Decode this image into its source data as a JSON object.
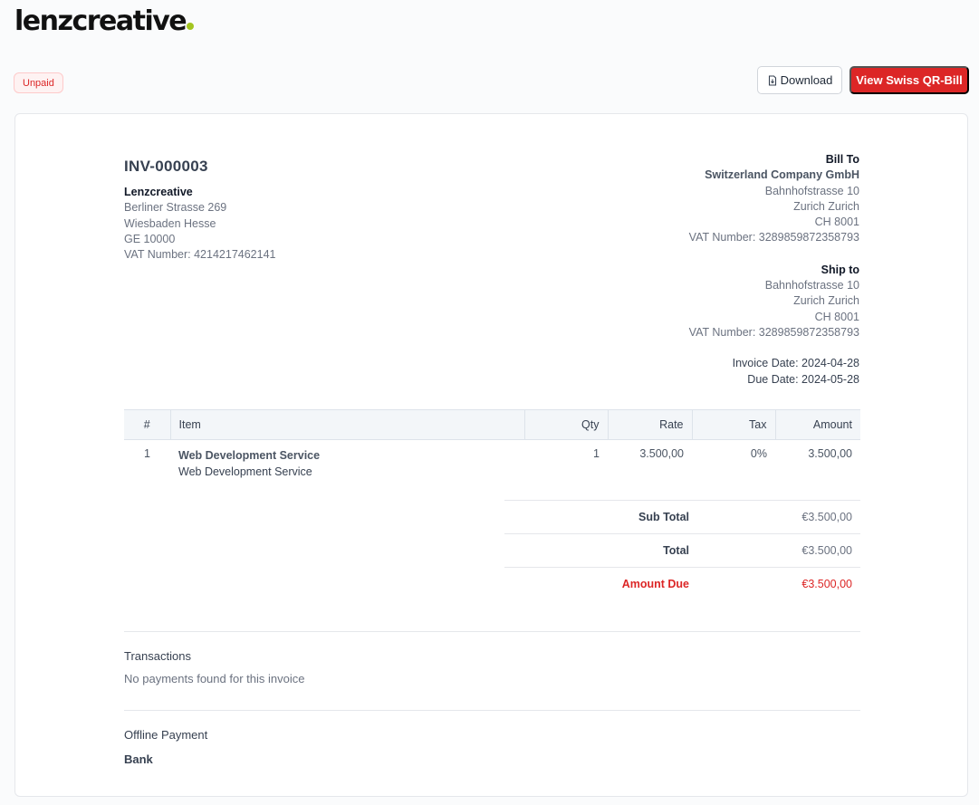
{
  "logo": {
    "text": "lenzcreative"
  },
  "status": {
    "label": "Unpaid"
  },
  "actions": {
    "download_label": "Download",
    "qr_label": "View Swiss QR-Bill"
  },
  "invoice": {
    "number": "INV-000003",
    "from": {
      "name": "Lenzcreative",
      "lines": [
        "Berliner Strasse 269",
        "Wiesbaden Hesse",
        "GE 10000",
        "VAT Number: 4214217462141"
      ]
    },
    "bill_to": {
      "heading": "Bill To",
      "company": "Switzerland Company GmbH",
      "lines": [
        "Bahnhofstrasse 10",
        "Zurich Zurich",
        "CH 8001",
        "VAT Number: 3289859872358793"
      ]
    },
    "ship_to": {
      "heading": "Ship to",
      "lines": [
        "Bahnhofstrasse 10",
        "Zurich Zurich",
        "CH 8001",
        "VAT Number: 3289859872358793"
      ]
    },
    "invoice_date": "Invoice Date: 2024-04-28",
    "due_date": "Due Date: 2024-05-28"
  },
  "table": {
    "headers": {
      "num": "#",
      "item": "Item",
      "qty": "Qty",
      "rate": "Rate",
      "tax": "Tax",
      "amount": "Amount"
    },
    "rows": [
      {
        "num": "1",
        "title": "Web Development Service",
        "desc": "Web Development Service",
        "qty": "1",
        "rate": "3.500,00",
        "tax": "0%",
        "amount": "3.500,00"
      }
    ]
  },
  "totals": {
    "sub_total_label": "Sub Total",
    "sub_total": "€3.500,00",
    "total_label": "Total",
    "total": "€3.500,00",
    "due_label": "Amount Due",
    "due": "€3.500,00"
  },
  "transactions": {
    "title": "Transactions",
    "empty": "No payments found for this invoice"
  },
  "payment": {
    "title": "Offline Payment",
    "method": "Bank"
  },
  "colors": {
    "accent": "#dc2626",
    "logo_dot": "#a3c520"
  }
}
